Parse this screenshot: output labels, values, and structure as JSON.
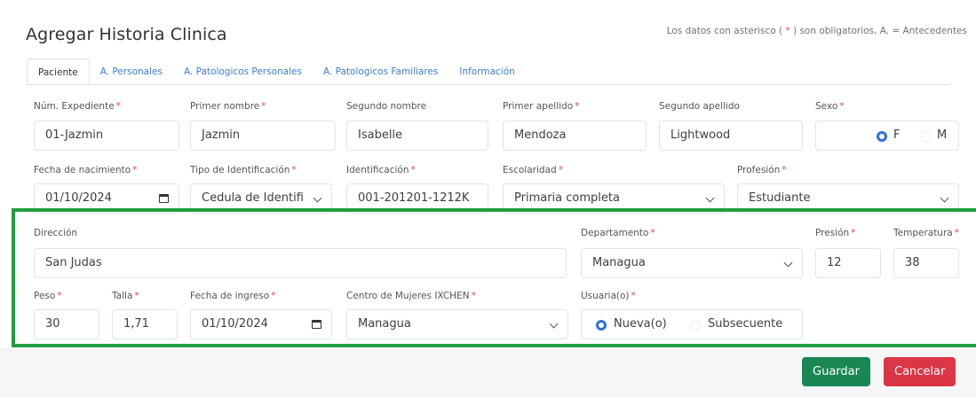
{
  "page": {
    "title": "Agregar Historia Clinica",
    "note_prefix": "Los datos con asterisco (",
    "note_asterisk": " * ",
    "note_suffix": ") son obligatorios,   A. = Antecedentes"
  },
  "tabs": [
    "Paciente",
    "A. Personales",
    "A. Patologicos Personales",
    "A. Patologicos Familiares",
    "Información"
  ],
  "required_mark": "*",
  "fields": {
    "expediente": {
      "label": "Núm. Expediente",
      "value": "01-Jazmin"
    },
    "primer_nombre": {
      "label": "Primer nombre",
      "value": "Jazmin"
    },
    "segundo_nombre": {
      "label": "Segundo nombre",
      "value": "Isabelle"
    },
    "primer_apellido": {
      "label": "Primer apellido",
      "value": "Mendoza"
    },
    "segundo_apellido": {
      "label": "Segundo apellido",
      "value": "Lightwood"
    },
    "sexo": {
      "label": "Sexo",
      "options": [
        "F",
        "M"
      ],
      "selected": "F"
    },
    "fecha_nacimiento": {
      "label": "Fecha de nacimiento",
      "value": "01/10/2024"
    },
    "tipo_identificacion": {
      "label": "Tipo de Identificación",
      "value": "Cedula de Identifi"
    },
    "identificacion": {
      "label": "Identificación",
      "value": "001-201201-1212K"
    },
    "escolaridad": {
      "label": "Escolaridad",
      "value": "Primaria completa"
    },
    "profesion": {
      "label": "Profesión",
      "value": "Estudiante"
    },
    "direccion": {
      "label": "Dirección",
      "value": "San Judas"
    },
    "departamento": {
      "label": "Departamento",
      "value": "Managua"
    },
    "presion": {
      "label": "Presión",
      "value": "12"
    },
    "temperatura": {
      "label": "Temperatura",
      "value": "38"
    },
    "peso": {
      "label": "Peso",
      "value": "30"
    },
    "talla": {
      "label": "Talla",
      "value": "1,71"
    },
    "fecha_ingreso": {
      "label": "Fecha de ingreso",
      "value": "01/10/2024"
    },
    "centro": {
      "label": "Centro de Mujeres IXCHEN",
      "value": "Managua"
    },
    "usuaria": {
      "label": "Usuaria(o)",
      "options": [
        "Nueva(o)",
        "Subsecuente"
      ],
      "selected": "Nueva(o)"
    }
  },
  "buttons": {
    "save": "Guardar",
    "cancel": "Cancelar"
  },
  "colors": {
    "accent": "#2f6fe0",
    "required": "#e04848",
    "save": "#198754",
    "cancel": "#dc3545",
    "highlight": "#1f9e3e"
  }
}
